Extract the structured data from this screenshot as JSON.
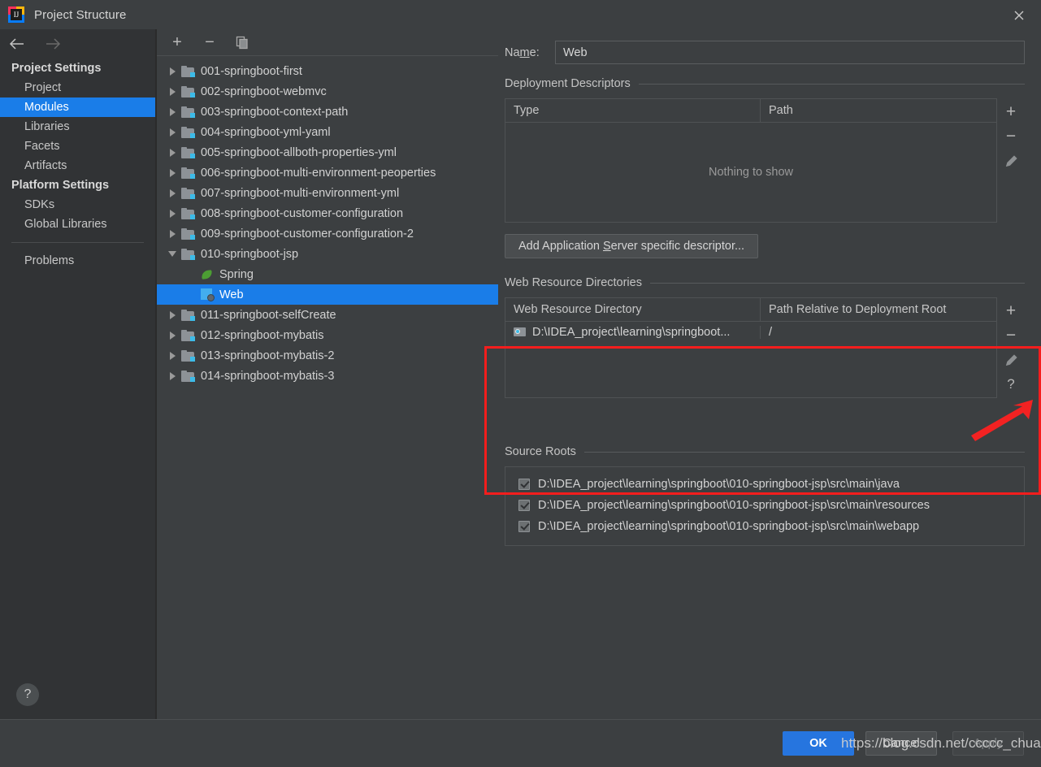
{
  "window": {
    "title": "Project Structure",
    "app_icon": "intellij-idea-icon",
    "close_icon": "close-icon"
  },
  "sidebar": {
    "back_icon": "arrow-left-icon",
    "forward_icon": "arrow-right-icon",
    "groups": [
      {
        "header": "Project Settings",
        "items": [
          {
            "label": "Project",
            "selected": false
          },
          {
            "label": "Modules",
            "selected": true
          },
          {
            "label": "Libraries",
            "selected": false
          },
          {
            "label": "Facets",
            "selected": false
          },
          {
            "label": "Artifacts",
            "selected": false
          }
        ]
      },
      {
        "header": "Platform Settings",
        "items": [
          {
            "label": "SDKs",
            "selected": false
          },
          {
            "label": "Global Libraries",
            "selected": false
          }
        ]
      }
    ],
    "problems_label": "Problems",
    "help_label": "?"
  },
  "tree": {
    "toolbar": {
      "add_label": "+",
      "remove_label": "−",
      "copy_icon": "copy-icon"
    },
    "rows": [
      {
        "label": "001-springboot-first",
        "type": "module",
        "expanded": false,
        "selected": false,
        "depth": 0
      },
      {
        "label": "002-springboot-webmvc",
        "type": "module",
        "expanded": false,
        "selected": false,
        "depth": 0
      },
      {
        "label": "003-springboot-context-path",
        "type": "module",
        "expanded": false,
        "selected": false,
        "depth": 0
      },
      {
        "label": "004-springboot-yml-yaml",
        "type": "module",
        "expanded": false,
        "selected": false,
        "depth": 0
      },
      {
        "label": "005-springboot-allboth-properties-yml",
        "type": "module",
        "expanded": false,
        "selected": false,
        "depth": 0
      },
      {
        "label": "006-springboot-multi-environment-peoperties",
        "type": "module",
        "expanded": false,
        "selected": false,
        "depth": 0
      },
      {
        "label": "007-springboot-multi-environment-yml",
        "type": "module",
        "expanded": false,
        "selected": false,
        "depth": 0
      },
      {
        "label": "008-springboot-customer-configuration",
        "type": "module",
        "expanded": false,
        "selected": false,
        "depth": 0
      },
      {
        "label": "009-springboot-customer-configuration-2",
        "type": "module",
        "expanded": false,
        "selected": false,
        "depth": 0
      },
      {
        "label": "010-springboot-jsp",
        "type": "module",
        "expanded": true,
        "selected": false,
        "depth": 0
      },
      {
        "label": "Spring",
        "type": "spring-facet",
        "expanded": false,
        "selected": false,
        "depth": 1
      },
      {
        "label": "Web",
        "type": "web-facet",
        "expanded": false,
        "selected": true,
        "depth": 1
      },
      {
        "label": "011-springboot-selfCreate",
        "type": "module",
        "expanded": false,
        "selected": false,
        "depth": 0
      },
      {
        "label": "012-springboot-mybatis",
        "type": "module",
        "expanded": false,
        "selected": false,
        "depth": 0
      },
      {
        "label": "013-springboot-mybatis-2",
        "type": "module",
        "expanded": false,
        "selected": false,
        "depth": 0
      },
      {
        "label": "014-springboot-mybatis-3",
        "type": "module",
        "expanded": false,
        "selected": false,
        "depth": 0
      }
    ]
  },
  "detail": {
    "name_label_a": "Na",
    "name_label_b": "m",
    "name_label_c": "e:",
    "name_value": "Web",
    "deployment": {
      "title": "Deployment Descriptors",
      "columns": [
        "Type",
        "Path"
      ],
      "empty_text": "Nothing to show",
      "rows": [],
      "actions": [
        "+",
        "−",
        "edit-pencil-icon"
      ],
      "button_a": "Add Application ",
      "button_b": "S",
      "button_c": "erver specific descriptor..."
    },
    "web_resources": {
      "title": "Web Resource Directories",
      "columns": [
        "Web Resource Directory",
        "Path Relative to Deployment Root"
      ],
      "rows": [
        {
          "directory": "D:\\IDEA_project\\learning\\springboot...",
          "relative_path": "/"
        }
      ],
      "actions": [
        "+",
        "−",
        "edit-pencil-icon",
        "?"
      ]
    },
    "source_roots": {
      "title": "Source Roots",
      "rows": [
        {
          "path": "D:\\IDEA_project\\learning\\springboot\\010-springboot-jsp\\src\\main\\java",
          "checked": true
        },
        {
          "path": "D:\\IDEA_project\\learning\\springboot\\010-springboot-jsp\\src\\main\\resources",
          "checked": true
        },
        {
          "path": "D:\\IDEA_project\\learning\\springboot\\010-springboot-jsp\\src\\main\\webapp",
          "checked": true
        }
      ]
    }
  },
  "footer": {
    "ok": "OK",
    "cancel": "Cancel",
    "apply": "Apply"
  },
  "annotations": {
    "watermark": "https://blog.csdn.net/ccccc_chuang",
    "highlight_color": "#f51d1d",
    "arrow_color": "#f32222"
  },
  "colors": {
    "accent_selection": "#1a7de8",
    "ok_button": "#2675df",
    "panel_bg": "#3c3f41",
    "sidebar_bg": "#313335"
  }
}
